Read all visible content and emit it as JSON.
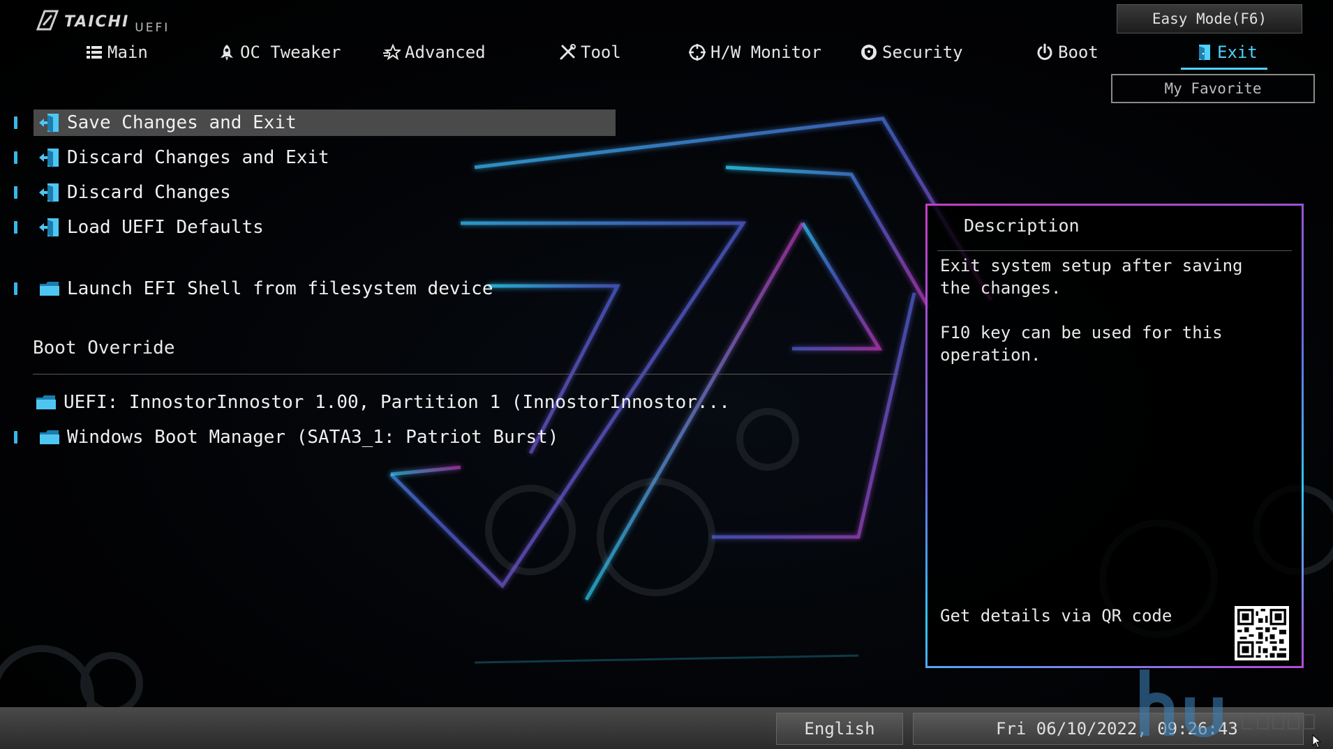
{
  "brand": {
    "name": "TAICHI",
    "sub": "UEFI"
  },
  "header": {
    "easy_mode": "Easy Mode(F6)",
    "my_favorite": "My Favorite"
  },
  "nav": [
    {
      "label": "Main",
      "icon": "list-icon"
    },
    {
      "label": "OC Tweaker",
      "icon": "rocket-icon"
    },
    {
      "label": "Advanced",
      "icon": "star-icon"
    },
    {
      "label": "Tool",
      "icon": "tools-icon"
    },
    {
      "label": "H/W Monitor",
      "icon": "crosshair-icon"
    },
    {
      "label": "Security",
      "icon": "shield-icon"
    },
    {
      "label": "Boot",
      "icon": "power-icon"
    },
    {
      "label": "Exit",
      "icon": "exit-door-icon",
      "active": true
    }
  ],
  "menu": {
    "items": [
      {
        "label": "Save Changes and Exit",
        "icon": "exit-door-icon",
        "selected": true
      },
      {
        "label": "Discard Changes and Exit",
        "icon": "exit-door-icon"
      },
      {
        "label": "Discard Changes",
        "icon": "exit-door-icon"
      },
      {
        "label": "Load UEFI Defaults",
        "icon": "exit-door-icon"
      },
      {
        "label": "Launch EFI Shell from filesystem device",
        "icon": "folder-icon"
      }
    ],
    "boot_override_title": "Boot Override",
    "boot_items": [
      {
        "label": "UEFI: InnostorInnostor 1.00, Partition 1 (InnostorInnostor...",
        "icon": "folder-icon"
      },
      {
        "label": "Windows Boot Manager (SATA3_1: Patriot Burst)",
        "icon": "folder-icon"
      }
    ]
  },
  "description": {
    "title": "Description",
    "line1": "Exit system setup after saving the changes.",
    "line2": "F10 key can be used for this operation.",
    "qr_text": "Get details via QR code"
  },
  "footer": {
    "language": "English",
    "datetime": "Fri 06/10/2022, 09:26:43"
  },
  "colors": {
    "accent": "#4fd2ff",
    "selected_row": "#4a4a4a",
    "marker": "#38b7e8",
    "panel_border_magenta": "#c83cc7",
    "panel_border_cyan": "#33c5ff"
  }
}
